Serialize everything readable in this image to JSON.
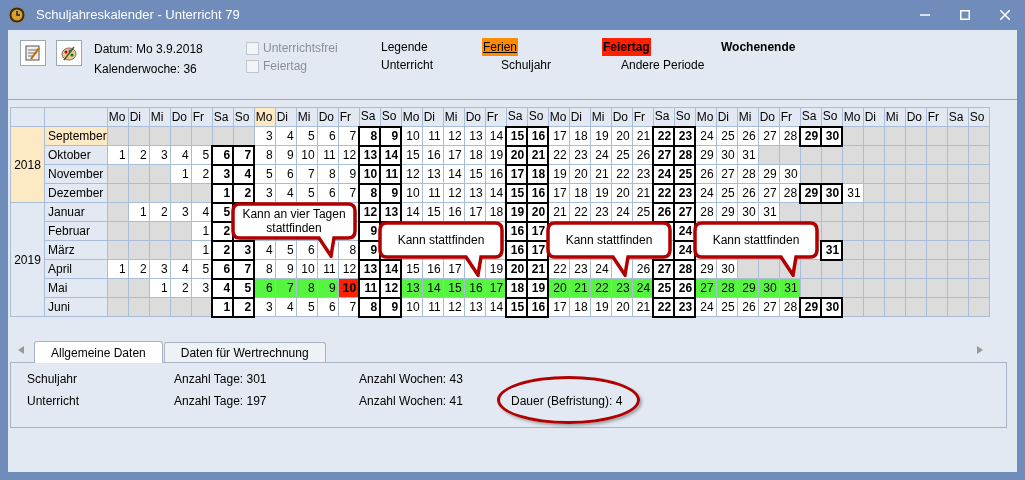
{
  "window": {
    "title": "Schuljahreskalender - Unterricht 79"
  },
  "toolbar": {
    "date": "Datum: Mo 3.9.2018",
    "week": "Kalenderwoche: 36",
    "checkboxes": [
      {
        "label": "Unterrichtsfrei",
        "checked": false,
        "disabled": true
      },
      {
        "label": "Feiertag",
        "checked": false,
        "disabled": true
      }
    ]
  },
  "legend": [
    {
      "label": "Legende",
      "kind": "plain"
    },
    {
      "label": "Ferien",
      "kind": "holidays"
    },
    {
      "label": "Feiertag",
      "kind": "public_holiday"
    },
    {
      "label": "Wochenende",
      "kind": "weekend"
    },
    {
      "label": "Unterricht",
      "kind": "plain"
    },
    {
      "label": "Schuljahr",
      "kind": "plain"
    },
    {
      "label": "Andere Periode",
      "kind": "plain"
    }
  ],
  "columns": [
    {
      "label": "Mo",
      "selected": false
    },
    {
      "label": "Di",
      "selected": false
    },
    {
      "label": "Mi",
      "selected": false
    },
    {
      "label": "Do",
      "selected": false
    },
    {
      "label": "Fr",
      "selected": false
    },
    {
      "label": "Sa",
      "selected": false
    },
    {
      "label": "So",
      "selected": false
    },
    {
      "label": "Mo",
      "selected": true
    },
    {
      "label": "Di",
      "selected": false
    },
    {
      "label": "Mi",
      "selected": false
    },
    {
      "label": "Do",
      "selected": false
    },
    {
      "label": "Fr",
      "selected": false
    },
    {
      "label": "Sa",
      "selected": false
    },
    {
      "label": "So",
      "selected": false
    },
    {
      "label": "Mo",
      "selected": false
    },
    {
      "label": "Di",
      "selected": false
    },
    {
      "label": "Mi",
      "selected": false
    },
    {
      "label": "Do",
      "selected": false
    },
    {
      "label": "Fr",
      "selected": false
    },
    {
      "label": "Sa",
      "selected": false
    },
    {
      "label": "So",
      "selected": false
    },
    {
      "label": "Mo",
      "selected": false
    },
    {
      "label": "Di",
      "selected": false
    },
    {
      "label": "Mi",
      "selected": false
    },
    {
      "label": "Do",
      "selected": false
    },
    {
      "label": "Fr",
      "selected": false
    },
    {
      "label": "Sa",
      "selected": false
    },
    {
      "label": "So",
      "selected": false
    },
    {
      "label": "Mo",
      "selected": false
    },
    {
      "label": "Di",
      "selected": false
    },
    {
      "label": "Mi",
      "selected": false
    },
    {
      "label": "Do",
      "selected": false
    },
    {
      "label": "Fr",
      "selected": false
    },
    {
      "label": "Sa",
      "selected": false
    },
    {
      "label": "So",
      "selected": false
    },
    {
      "label": "Mo",
      "selected": false
    },
    {
      "label": "Di",
      "selected": false
    },
    {
      "label": "Mi",
      "selected": false
    },
    {
      "label": "Do",
      "selected": false
    },
    {
      "label": "Fr",
      "selected": false
    },
    {
      "label": "Sa",
      "selected": false
    },
    {
      "label": "So",
      "selected": false
    }
  ],
  "years": [
    {
      "year": "2018",
      "selected": true,
      "months": [
        {
          "name": "September",
          "selected": true,
          "days": [
            {
              "kind": "empty"
            },
            {
              "kind": "empty"
            },
            {
              "kind": "empty"
            },
            {
              "kind": "empty"
            },
            {
              "kind": "empty"
            },
            {
              "kind": "empty"
            },
            {
              "kind": "empty"
            },
            {
              "kind": "day",
              "d": "3"
            },
            {
              "kind": "day",
              "d": "4"
            },
            {
              "kind": "day",
              "d": "5"
            },
            {
              "kind": "day",
              "d": "6"
            },
            {
              "kind": "day",
              "d": "7"
            },
            {
              "kind": "weekend",
              "d": "8"
            },
            {
              "kind": "weekend",
              "d": "9"
            },
            {
              "kind": "day",
              "d": "10"
            },
            {
              "kind": "day",
              "d": "11"
            },
            {
              "kind": "day",
              "d": "12"
            },
            {
              "kind": "day",
              "d": "13"
            },
            {
              "kind": "day",
              "d": "14"
            },
            {
              "kind": "weekend",
              "d": "15"
            },
            {
              "kind": "weekend",
              "d": "16"
            },
            {
              "kind": "day",
              "d": "17"
            },
            {
              "kind": "day",
              "d": "18"
            },
            {
              "kind": "day",
              "d": "19"
            },
            {
              "kind": "day",
              "d": "20"
            },
            {
              "kind": "day",
              "d": "21"
            },
            {
              "kind": "weekend",
              "d": "22"
            },
            {
              "kind": "weekend",
              "d": "23"
            },
            {
              "kind": "day",
              "d": "24"
            },
            {
              "kind": "day",
              "d": "25"
            },
            {
              "kind": "day",
              "d": "26"
            },
            {
              "kind": "day",
              "d": "27"
            },
            {
              "kind": "day",
              "d": "28"
            },
            {
              "kind": "weekend",
              "d": "29"
            },
            {
              "kind": "weekend",
              "d": "30"
            },
            {
              "kind": "empty"
            },
            {
              "kind": "empty"
            },
            {
              "kind": "empty"
            },
            {
              "kind": "empty"
            },
            {
              "kind": "empty"
            },
            {
              "kind": "empty"
            },
            {
              "kind": "empty"
            }
          ]
        },
        {
          "name": "Oktober",
          "selected": false,
          "days": [
            {
              "kind": "day",
              "d": "1"
            },
            {
              "kind": "day",
              "d": "2"
            },
            {
              "kind": "day",
              "d": "3"
            },
            {
              "kind": "day",
              "d": "4"
            },
            {
              "kind": "day",
              "d": "5"
            },
            {
              "kind": "weekend",
              "d": "6"
            },
            {
              "kind": "weekend",
              "d": "7"
            },
            {
              "kind": "day",
              "d": "8"
            },
            {
              "kind": "day",
              "d": "9"
            },
            {
              "kind": "day",
              "d": "10"
            },
            {
              "kind": "day",
              "d": "11"
            },
            {
              "kind": "day",
              "d": "12"
            },
            {
              "kind": "weekend",
              "d": "13"
            },
            {
              "kind": "weekend",
              "d": "14"
            },
            {
              "kind": "day",
              "d": "15"
            },
            {
              "kind": "day",
              "d": "16"
            },
            {
              "kind": "day",
              "d": "17"
            },
            {
              "kind": "day",
              "d": "18"
            },
            {
              "kind": "day",
              "d": "19"
            },
            {
              "kind": "weekend",
              "d": "20"
            },
            {
              "kind": "weekend",
              "d": "21"
            },
            {
              "kind": "day",
              "d": "22"
            },
            {
              "kind": "day",
              "d": "23"
            },
            {
              "kind": "day",
              "d": "24"
            },
            {
              "kind": "day",
              "d": "25"
            },
            {
              "kind": "day",
              "d": "26"
            },
            {
              "kind": "weekend",
              "d": "27"
            },
            {
              "kind": "weekend",
              "d": "28"
            },
            {
              "kind": "day",
              "d": "29"
            },
            {
              "kind": "day",
              "d": "30"
            },
            {
              "kind": "day",
              "d": "31"
            },
            {
              "kind": "empty"
            },
            {
              "kind": "empty"
            },
            {
              "kind": "empty"
            },
            {
              "kind": "empty"
            },
            {
              "kind": "empty"
            },
            {
              "kind": "empty"
            },
            {
              "kind": "empty"
            },
            {
              "kind": "empty"
            },
            {
              "kind": "empty"
            },
            {
              "kind": "empty"
            },
            {
              "kind": "empty"
            }
          ]
        },
        {
          "name": "November",
          "selected": false,
          "days": [
            {
              "kind": "empty"
            },
            {
              "kind": "empty"
            },
            {
              "kind": "empty"
            },
            {
              "kind": "day",
              "d": "1"
            },
            {
              "kind": "day",
              "d": "2"
            },
            {
              "kind": "weekend",
              "d": "3"
            },
            {
              "kind": "weekend",
              "d": "4"
            },
            {
              "kind": "day",
              "d": "5"
            },
            {
              "kind": "day",
              "d": "6"
            },
            {
              "kind": "day",
              "d": "7"
            },
            {
              "kind": "day",
              "d": "8"
            },
            {
              "kind": "day",
              "d": "9"
            },
            {
              "kind": "weekend",
              "d": "10"
            },
            {
              "kind": "weekend",
              "d": "11"
            },
            {
              "kind": "day",
              "d": "12"
            },
            {
              "kind": "day",
              "d": "13"
            },
            {
              "kind": "day",
              "d": "14"
            },
            {
              "kind": "day",
              "d": "15"
            },
            {
              "kind": "day",
              "d": "16"
            },
            {
              "kind": "weekend",
              "d": "17"
            },
            {
              "kind": "weekend",
              "d": "18"
            },
            {
              "kind": "day",
              "d": "19"
            },
            {
              "kind": "day",
              "d": "20"
            },
            {
              "kind": "day",
              "d": "21"
            },
            {
              "kind": "day",
              "d": "22"
            },
            {
              "kind": "day",
              "d": "23"
            },
            {
              "kind": "weekend",
              "d": "24"
            },
            {
              "kind": "weekend",
              "d": "25"
            },
            {
              "kind": "day",
              "d": "26"
            },
            {
              "kind": "day",
              "d": "27"
            },
            {
              "kind": "day",
              "d": "28"
            },
            {
              "kind": "day",
              "d": "29"
            },
            {
              "kind": "day",
              "d": "30"
            },
            {
              "kind": "empty"
            },
            {
              "kind": "empty"
            },
            {
              "kind": "empty"
            },
            {
              "kind": "empty"
            },
            {
              "kind": "empty"
            },
            {
              "kind": "empty"
            },
            {
              "kind": "empty"
            },
            {
              "kind": "empty"
            },
            {
              "kind": "empty"
            }
          ]
        },
        {
          "name": "Dezember",
          "selected": false,
          "days": [
            {
              "kind": "empty"
            },
            {
              "kind": "empty"
            },
            {
              "kind": "empty"
            },
            {
              "kind": "empty"
            },
            {
              "kind": "empty"
            },
            {
              "kind": "weekend",
              "d": "1"
            },
            {
              "kind": "weekend",
              "d": "2"
            },
            {
              "kind": "day",
              "d": "3"
            },
            {
              "kind": "day",
              "d": "4"
            },
            {
              "kind": "day",
              "d": "5"
            },
            {
              "kind": "day",
              "d": "6"
            },
            {
              "kind": "day",
              "d": "7"
            },
            {
              "kind": "weekend",
              "d": "8"
            },
            {
              "kind": "weekend",
              "d": "9"
            },
            {
              "kind": "day",
              "d": "10"
            },
            {
              "kind": "day",
              "d": "11"
            },
            {
              "kind": "day",
              "d": "12"
            },
            {
              "kind": "day",
              "d": "13"
            },
            {
              "kind": "day",
              "d": "14"
            },
            {
              "kind": "weekend",
              "d": "15"
            },
            {
              "kind": "weekend",
              "d": "16"
            },
            {
              "kind": "day",
              "d": "17"
            },
            {
              "kind": "day",
              "d": "18"
            },
            {
              "kind": "day",
              "d": "19"
            },
            {
              "kind": "day",
              "d": "20"
            },
            {
              "kind": "day",
              "d": "21"
            },
            {
              "kind": "weekend",
              "d": "22"
            },
            {
              "kind": "weekend",
              "d": "23"
            },
            {
              "kind": "day",
              "d": "24"
            },
            {
              "kind": "day",
              "d": "25"
            },
            {
              "kind": "day",
              "d": "26"
            },
            {
              "kind": "day",
              "d": "27"
            },
            {
              "kind": "day",
              "d": "28"
            },
            {
              "kind": "weekend",
              "d": "29"
            },
            {
              "kind": "weekend",
              "d": "30"
            },
            {
              "kind": "day",
              "d": "31"
            },
            {
              "kind": "empty"
            },
            {
              "kind": "empty"
            },
            {
              "kind": "empty"
            },
            {
              "kind": "empty"
            },
            {
              "kind": "empty"
            },
            {
              "kind": "empty"
            }
          ]
        }
      ]
    },
    {
      "year": "2019",
      "selected": false,
      "months": [
        {
          "name": "Januar",
          "selected": false,
          "days": [
            {
              "kind": "empty"
            },
            {
              "kind": "day",
              "d": "1"
            },
            {
              "kind": "day",
              "d": "2"
            },
            {
              "kind": "day",
              "d": "3"
            },
            {
              "kind": "day",
              "d": "4"
            },
            {
              "kind": "weekend",
              "d": "5"
            },
            {
              "kind": "hidden"
            },
            {
              "kind": "hidden"
            },
            {
              "kind": "hidden"
            },
            {
              "kind": "hidden"
            },
            {
              "kind": "hidden"
            },
            {
              "kind": "hidden"
            },
            {
              "kind": "weekend",
              "d": "12"
            },
            {
              "kind": "weekend",
              "d": "13"
            },
            {
              "kind": "day",
              "d": "14"
            },
            {
              "kind": "day",
              "d": "15"
            },
            {
              "kind": "day",
              "d": "16"
            },
            {
              "kind": "day",
              "d": "17"
            },
            {
              "kind": "day",
              "d": "18"
            },
            {
              "kind": "weekend",
              "d": "19"
            },
            {
              "kind": "weekend",
              "d": "20"
            },
            {
              "kind": "day",
              "d": "21"
            },
            {
              "kind": "day",
              "d": "22"
            },
            {
              "kind": "day",
              "d": "23"
            },
            {
              "kind": "day",
              "d": "24"
            },
            {
              "kind": "day",
              "d": "25"
            },
            {
              "kind": "weekend",
              "d": "26"
            },
            {
              "kind": "weekend",
              "d": "27"
            },
            {
              "kind": "day",
              "d": "28"
            },
            {
              "kind": "day",
              "d": "29"
            },
            {
              "kind": "day",
              "d": "30"
            },
            {
              "kind": "day",
              "d": "31"
            },
            {
              "kind": "empty"
            },
            {
              "kind": "empty"
            },
            {
              "kind": "empty"
            },
            {
              "kind": "empty"
            },
            {
              "kind": "empty"
            },
            {
              "kind": "empty"
            },
            {
              "kind": "empty"
            },
            {
              "kind": "empty"
            },
            {
              "kind": "empty"
            },
            {
              "kind": "empty"
            }
          ]
        },
        {
          "name": "Februar",
          "selected": false,
          "days": [
            {
              "kind": "empty"
            },
            {
              "kind": "empty"
            },
            {
              "kind": "empty"
            },
            {
              "kind": "empty"
            },
            {
              "kind": "day",
              "d": "1"
            },
            {
              "kind": "weekend",
              "d": "2"
            },
            {
              "kind": "hidden"
            },
            {
              "kind": "hidden"
            },
            {
              "kind": "hidden"
            },
            {
              "kind": "hidden"
            },
            {
              "kind": "hidden"
            },
            {
              "kind": "hidden"
            },
            {
              "kind": "weekend",
              "d": "9"
            },
            {
              "kind": "hidden"
            },
            {
              "kind": "hidden"
            },
            {
              "kind": "hidden"
            },
            {
              "kind": "hidden"
            },
            {
              "kind": "hidden"
            },
            {
              "kind": "hidden"
            },
            {
              "kind": "weekend",
              "d": "16"
            },
            {
              "kind": "weekend",
              "d": "17"
            },
            {
              "kind": "hidden"
            },
            {
              "kind": "hidden"
            },
            {
              "kind": "hidden"
            },
            {
              "kind": "hidden"
            },
            {
              "kind": "hidden"
            },
            {
              "kind": "hidden"
            },
            {
              "kind": "weekend",
              "d": "24"
            },
            {
              "kind": "hidden"
            },
            {
              "kind": "hidden"
            },
            {
              "kind": "hidden"
            },
            {
              "kind": "hidden"
            },
            {
              "kind": "empty"
            },
            {
              "kind": "empty"
            },
            {
              "kind": "empty"
            },
            {
              "kind": "empty"
            },
            {
              "kind": "empty"
            },
            {
              "kind": "empty"
            },
            {
              "kind": "empty"
            },
            {
              "kind": "empty"
            },
            {
              "kind": "empty"
            },
            {
              "kind": "empty"
            }
          ]
        },
        {
          "name": "März",
          "selected": false,
          "days": [
            {
              "kind": "empty"
            },
            {
              "kind": "empty"
            },
            {
              "kind": "empty"
            },
            {
              "kind": "empty"
            },
            {
              "kind": "day",
              "d": "1"
            },
            {
              "kind": "weekend",
              "d": "2"
            },
            {
              "kind": "weekend",
              "d": "3"
            },
            {
              "kind": "day",
              "d": "4"
            },
            {
              "kind": "day",
              "d": "5"
            },
            {
              "kind": "day",
              "d": "6"
            },
            {
              "kind": "hidden"
            },
            {
              "kind": "day",
              "d": "8"
            },
            {
              "kind": "weekend",
              "d": "9"
            },
            {
              "kind": "hidden"
            },
            {
              "kind": "hidden"
            },
            {
              "kind": "hidden"
            },
            {
              "kind": "hidden"
            },
            {
              "kind": "hidden"
            },
            {
              "kind": "hidden"
            },
            {
              "kind": "weekend",
              "d": "16"
            },
            {
              "kind": "weekend",
              "d": "17"
            },
            {
              "kind": "hidden"
            },
            {
              "kind": "hidden"
            },
            {
              "kind": "hidden"
            },
            {
              "kind": "hidden"
            },
            {
              "kind": "hidden"
            },
            {
              "kind": "hidden"
            },
            {
              "kind": "weekend",
              "d": "24"
            },
            {
              "kind": "hidden"
            },
            {
              "kind": "hidden"
            },
            {
              "kind": "hidden"
            },
            {
              "kind": "hidden"
            },
            {
              "kind": "hidden"
            },
            {
              "kind": "hidden"
            },
            {
              "kind": "weekend",
              "d": "31"
            },
            {
              "kind": "empty"
            },
            {
              "kind": "empty"
            },
            {
              "kind": "empty"
            },
            {
              "kind": "empty"
            },
            {
              "kind": "empty"
            },
            {
              "kind": "empty"
            },
            {
              "kind": "empty"
            }
          ]
        },
        {
          "name": "April",
          "selected": false,
          "days": [
            {
              "kind": "day",
              "d": "1"
            },
            {
              "kind": "day",
              "d": "2"
            },
            {
              "kind": "day",
              "d": "3"
            },
            {
              "kind": "day",
              "d": "4"
            },
            {
              "kind": "day",
              "d": "5"
            },
            {
              "kind": "weekend",
              "d": "6"
            },
            {
              "kind": "weekend",
              "d": "7"
            },
            {
              "kind": "day",
              "d": "8"
            },
            {
              "kind": "day",
              "d": "9"
            },
            {
              "kind": "day",
              "d": "10"
            },
            {
              "kind": "day",
              "d": "11"
            },
            {
              "kind": "day",
              "d": "12"
            },
            {
              "kind": "weekend",
              "d": "13"
            },
            {
              "kind": "weekend",
              "d": "14"
            },
            {
              "kind": "day",
              "d": "15"
            },
            {
              "kind": "day",
              "d": "16"
            },
            {
              "kind": "day",
              "d": "17"
            },
            {
              "kind": "hidden"
            },
            {
              "kind": "day",
              "d": "19"
            },
            {
              "kind": "weekend",
              "d": "20"
            },
            {
              "kind": "weekend",
              "d": "21"
            },
            {
              "kind": "day",
              "d": "22"
            },
            {
              "kind": "day",
              "d": "23"
            },
            {
              "kind": "day",
              "d": "24"
            },
            {
              "kind": "hidden"
            },
            {
              "kind": "day",
              "d": "26"
            },
            {
              "kind": "weekend",
              "d": "27"
            },
            {
              "kind": "weekend",
              "d": "28"
            },
            {
              "kind": "day",
              "d": "29"
            },
            {
              "kind": "day",
              "d": "30"
            },
            {
              "kind": "empty"
            },
            {
              "kind": "empty"
            },
            {
              "kind": "empty"
            },
            {
              "kind": "empty"
            },
            {
              "kind": "empty"
            },
            {
              "kind": "empty"
            },
            {
              "kind": "empty"
            },
            {
              "kind": "empty"
            },
            {
              "kind": "empty"
            },
            {
              "kind": "empty"
            },
            {
              "kind": "empty"
            },
            {
              "kind": "empty"
            }
          ]
        },
        {
          "name": "Mai",
          "selected": false,
          "days": [
            {
              "kind": "empty"
            },
            {
              "kind": "empty"
            },
            {
              "kind": "day",
              "d": "1"
            },
            {
              "kind": "day",
              "d": "2"
            },
            {
              "kind": "day",
              "d": "3"
            },
            {
              "kind": "weekend",
              "d": "4"
            },
            {
              "kind": "weekend",
              "d": "5"
            },
            {
              "kind": "possible",
              "d": "6"
            },
            {
              "kind": "possible",
              "d": "7"
            },
            {
              "kind": "possible",
              "d": "8"
            },
            {
              "kind": "possible",
              "d": "9"
            },
            {
              "kind": "holiday",
              "d": "10"
            },
            {
              "kind": "weekend",
              "d": "11"
            },
            {
              "kind": "weekend",
              "d": "12"
            },
            {
              "kind": "possible",
              "d": "13"
            },
            {
              "kind": "possible",
              "d": "14"
            },
            {
              "kind": "possible",
              "d": "15"
            },
            {
              "kind": "possible",
              "d": "16"
            },
            {
              "kind": "possible",
              "d": "17"
            },
            {
              "kind": "weekend",
              "d": "18"
            },
            {
              "kind": "weekend",
              "d": "19"
            },
            {
              "kind": "possible",
              "d": "20"
            },
            {
              "kind": "possible",
              "d": "21"
            },
            {
              "kind": "possible",
              "d": "22"
            },
            {
              "kind": "possible",
              "d": "23"
            },
            {
              "kind": "possible",
              "d": "24"
            },
            {
              "kind": "weekend",
              "d": "25"
            },
            {
              "kind": "weekend",
              "d": "26"
            },
            {
              "kind": "possible",
              "d": "27"
            },
            {
              "kind": "possible",
              "d": "28"
            },
            {
              "kind": "possible",
              "d": "29"
            },
            {
              "kind": "possible",
              "d": "30"
            },
            {
              "kind": "possible",
              "d": "31"
            },
            {
              "kind": "empty"
            },
            {
              "kind": "empty"
            },
            {
              "kind": "empty"
            },
            {
              "kind": "empty"
            },
            {
              "kind": "empty"
            },
            {
              "kind": "empty"
            },
            {
              "kind": "empty"
            },
            {
              "kind": "empty"
            },
            {
              "kind": "empty"
            }
          ]
        },
        {
          "name": "Juni",
          "selected": false,
          "days": [
            {
              "kind": "empty"
            },
            {
              "kind": "empty"
            },
            {
              "kind": "empty"
            },
            {
              "kind": "empty"
            },
            {
              "kind": "empty"
            },
            {
              "kind": "weekend",
              "d": "1"
            },
            {
              "kind": "weekend",
              "d": "2"
            },
            {
              "kind": "day",
              "d": "3"
            },
            {
              "kind": "day",
              "d": "4"
            },
            {
              "kind": "day",
              "d": "5"
            },
            {
              "kind": "day",
              "d": "6"
            },
            {
              "kind": "day",
              "d": "7"
            },
            {
              "kind": "weekend",
              "d": "8"
            },
            {
              "kind": "weekend",
              "d": "9"
            },
            {
              "kind": "day",
              "d": "10"
            },
            {
              "kind": "day",
              "d": "11"
            },
            {
              "kind": "day",
              "d": "12"
            },
            {
              "kind": "day",
              "d": "13"
            },
            {
              "kind": "day",
              "d": "14"
            },
            {
              "kind": "weekend",
              "d": "15"
            },
            {
              "kind": "weekend",
              "d": "16"
            },
            {
              "kind": "day",
              "d": "17"
            },
            {
              "kind": "day",
              "d": "18"
            },
            {
              "kind": "day",
              "d": "19"
            },
            {
              "kind": "day",
              "d": "20"
            },
            {
              "kind": "day",
              "d": "21"
            },
            {
              "kind": "weekend",
              "d": "22"
            },
            {
              "kind": "weekend",
              "d": "23"
            },
            {
              "kind": "day",
              "d": "24"
            },
            {
              "kind": "day",
              "d": "25"
            },
            {
              "kind": "day",
              "d": "26"
            },
            {
              "kind": "day",
              "d": "27"
            },
            {
              "kind": "day",
              "d": "28"
            },
            {
              "kind": "weekend",
              "d": "29"
            },
            {
              "kind": "weekend",
              "d": "30"
            },
            {
              "kind": "empty"
            },
            {
              "kind": "empty"
            },
            {
              "kind": "empty"
            },
            {
              "kind": "empty"
            },
            {
              "kind": "empty"
            },
            {
              "kind": "empty"
            },
            {
              "kind": "empty"
            }
          ]
        }
      ]
    }
  ],
  "callouts": [
    {
      "text": "Kann an vier Tagen stattfinden"
    },
    {
      "text": "Kann stattfinden"
    },
    {
      "text": "Kann stattfinden"
    },
    {
      "text": "Kann stattfinden"
    }
  ],
  "tabs": [
    {
      "label": "Allgemeine Daten",
      "selected": true
    },
    {
      "label": "Daten für Wertrechnung",
      "selected": false
    }
  ],
  "summary": [
    {
      "label": "Schuljahr",
      "days": "Anzahl Tage: 301",
      "weeks": "Anzahl Wochen: 43"
    },
    {
      "label": "Unterricht",
      "days": "Anzahl Tage: 197",
      "weeks": "Anzahl Wochen: 41",
      "duration": "Dauer (Befristung): 4"
    }
  ]
}
